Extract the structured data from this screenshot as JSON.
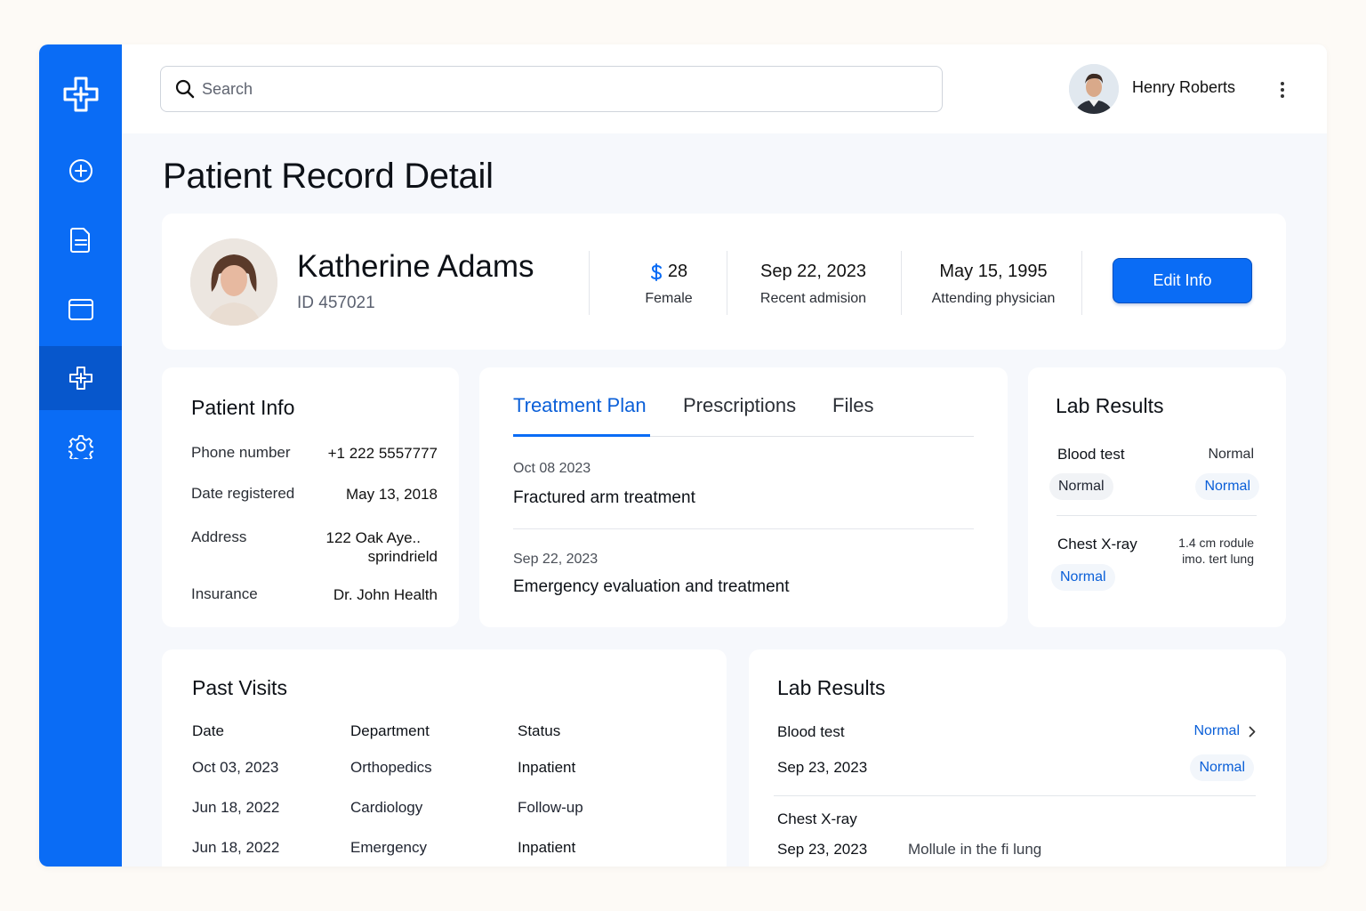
{
  "header": {
    "search_placeholder": "Search",
    "user_name": "Henry Roberts"
  },
  "page": {
    "title": "Patient Record Detail"
  },
  "patient": {
    "name": "Katherine Adams",
    "id": "ID 457021",
    "stats": [
      {
        "value": "28",
        "label": "Female"
      },
      {
        "value": "Sep 22, 2023",
        "label": "Recent admision"
      },
      {
        "value": "May 15, 1995",
        "label": "Attending physician"
      }
    ],
    "edit_label": "Edit Info"
  },
  "patient_info": {
    "title": "Patient Info",
    "rows": [
      {
        "label": "Phone number",
        "value": "+1 222 5557777"
      },
      {
        "label": "Date registered",
        "value": "May 13, 2018"
      },
      {
        "label": "Address",
        "value": "122 Oak Aye..",
        "value2": "sprindrield"
      },
      {
        "label": "Insurance",
        "value": "Dr. John Health"
      }
    ]
  },
  "treatment": {
    "tabs": [
      "Treatment Plan",
      "Prescriptions",
      "Files"
    ],
    "entries": [
      {
        "date": "Oct 08 2023",
        "title": "Fractured arm treatment"
      },
      {
        "date": "Sep 22, 2023",
        "title": "Emergency evaluation and treatment"
      }
    ]
  },
  "lab_results_side": {
    "title": "Lab Results",
    "items": [
      {
        "label": "Blood test",
        "value": "Normal",
        "pill_left": "Normal",
        "pill_right": "Normal"
      },
      {
        "label": "Chest X-ray",
        "note1": "1.4 cm rodule",
        "note2": "imo. tert lung",
        "pill_left": "Normal"
      }
    ]
  },
  "past_visits": {
    "title": "Past Visits",
    "headers": [
      "Date",
      "Department",
      "Status"
    ],
    "rows": [
      [
        "Oct 03, 2023",
        "Orthopedics",
        "Inpatient"
      ],
      [
        "Jun 18, 2022",
        "Cardiology",
        "Follow-up"
      ],
      [
        "Jun 18, 2022",
        "Emergency",
        "Inpatient"
      ]
    ]
  },
  "lab_results_main": {
    "title": "Lab Results",
    "items": [
      {
        "label": "Blood test",
        "link": "Normal",
        "date": "Sep 23, 2023",
        "status": "Normal"
      },
      {
        "label": "Chest X-ray",
        "date": "Sep 23, 2023",
        "note": "Mollule in the fi lung"
      }
    ]
  },
  "colors": {
    "primary": "#0a6cf5",
    "primary_dark": "#0757cc",
    "link": "#0a5fd8"
  },
  "icons": [
    "medical-cross-logo-icon",
    "plus-circle-icon",
    "document-icon",
    "window-icon",
    "medical-cross-icon",
    "gear-icon",
    "search-icon",
    "kebab-icon",
    "dollar-icon",
    "chevron-right-icon"
  ]
}
